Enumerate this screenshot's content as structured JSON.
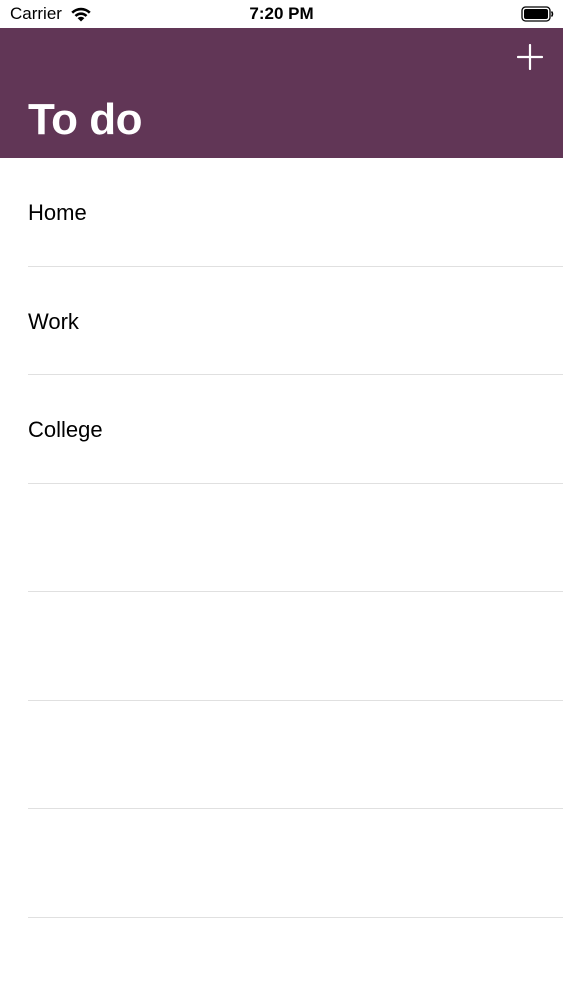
{
  "status_bar": {
    "carrier": "Carrier",
    "time": "7:20 PM",
    "icons": [
      "wifi-icon",
      "battery-icon"
    ]
  },
  "nav_bar": {
    "title": "To do",
    "background_color": "#613656",
    "add_icon": "plus-icon"
  },
  "list": {
    "items": [
      {
        "label": "Home"
      },
      {
        "label": "Work"
      },
      {
        "label": "College"
      },
      {
        "label": ""
      },
      {
        "label": ""
      },
      {
        "label": ""
      },
      {
        "label": ""
      }
    ]
  }
}
